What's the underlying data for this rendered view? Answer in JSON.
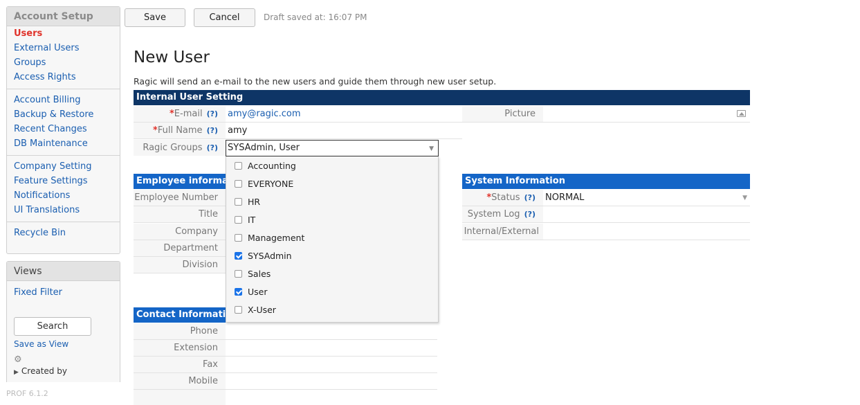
{
  "sidebar": {
    "setup_title": "Account Setup",
    "group1": [
      "Users",
      "External Users",
      "Groups",
      "Access Rights"
    ],
    "group2": [
      "Account Billing",
      "Backup & Restore",
      "Recent Changes",
      "DB Maintenance"
    ],
    "group3": [
      "Company Setting",
      "Feature Settings",
      "Notifications",
      "UI Translations"
    ],
    "group4": [
      "Recycle Bin"
    ],
    "views_title": "Views",
    "fixed_filter": "Fixed Filter",
    "search_label": "Search",
    "save_as_view": "Save as View",
    "created_by": "Created by",
    "version": "PROF 6.1.2"
  },
  "toolbar": {
    "save_label": "Save",
    "cancel_label": "Cancel",
    "draft_status": "Draft saved at: 16:07 PM"
  },
  "page": {
    "title": "New User",
    "intro": "Ragic will send an e-mail to the new users and guide them through new user setup."
  },
  "internal": {
    "title": "Internal User Setting",
    "required_mark": "*",
    "help_mark": "(?)",
    "email_label": "E-mail",
    "email_value": "amy@ragic.com",
    "fullname_label": "Full Name",
    "fullname_value": "amy",
    "groups_label": "Ragic Groups",
    "groups_value": "SYSAdmin, User",
    "picture_label": "Picture"
  },
  "groups_dropdown": {
    "options": [
      {
        "label": "Accounting",
        "checked": false
      },
      {
        "label": "EVERYONE",
        "checked": false
      },
      {
        "label": "HR",
        "checked": false
      },
      {
        "label": "IT",
        "checked": false
      },
      {
        "label": "Management",
        "checked": false
      },
      {
        "label": "SYSAdmin",
        "checked": true
      },
      {
        "label": "Sales",
        "checked": false
      },
      {
        "label": "User",
        "checked": true
      },
      {
        "label": "X-User",
        "checked": false
      }
    ]
  },
  "employee": {
    "title": "Employee information",
    "fields": [
      "Employee Number",
      "Title",
      "Company",
      "Department",
      "Division"
    ]
  },
  "system": {
    "title": "System Information",
    "status_label": "Status",
    "status_value": "NORMAL",
    "system_log_label": "System Log",
    "internal_external_label": "Internal/External"
  },
  "contact": {
    "title": "Contact Information",
    "fields": [
      "Phone",
      "Extension",
      "Fax",
      "Mobile"
    ]
  },
  "colors": {
    "dark_bar": "#0e3566",
    "blue_bar": "#1465c7",
    "active_link": "#e0332b",
    "link": "#1a5eb0"
  }
}
